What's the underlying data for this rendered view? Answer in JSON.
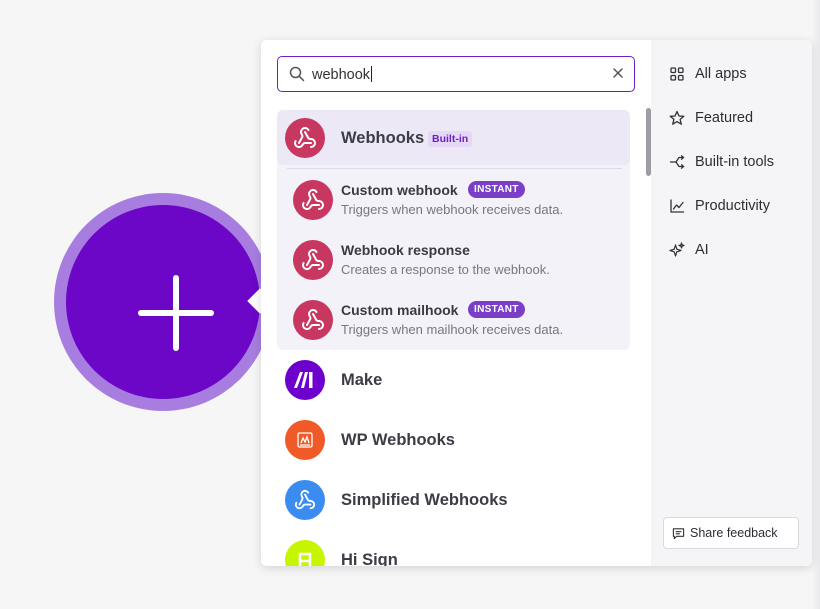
{
  "search": {
    "value": "webhook"
  },
  "group": {
    "title": "Webhooks",
    "badge": "Built-in",
    "modules": [
      {
        "title": "Custom webhook",
        "badge": "INSTANT",
        "desc": "Triggers when webhook receives data."
      },
      {
        "title": "Webhook response",
        "badge": "",
        "desc": "Creates a response to the webhook."
      },
      {
        "title": "Custom mailhook",
        "badge": "INSTANT",
        "desc": "Triggers when mailhook receives data."
      }
    ]
  },
  "apps": [
    {
      "name": "Make",
      "icon": "make-icon",
      "color": "#6d00cc"
    },
    {
      "name": "WP Webhooks",
      "icon": "wp-webhooks-icon",
      "color": "#f05a28"
    },
    {
      "name": "Simplified Webhooks",
      "icon": "webhook-icon",
      "color": "#3b8cf0"
    },
    {
      "name": "Hi Sign",
      "icon": "hi-sign-icon",
      "color": "#c6f500"
    }
  ],
  "categories": [
    {
      "label": "All apps",
      "icon": "grid-icon"
    },
    {
      "label": "Featured",
      "icon": "star-icon"
    },
    {
      "label": "Built-in tools",
      "icon": "branch-icon"
    },
    {
      "label": "Productivity",
      "icon": "trend-icon"
    },
    {
      "label": "AI",
      "icon": "sparkle-icon"
    }
  ],
  "feedback": {
    "label": "Share feedback"
  },
  "colors": {
    "accent": "#6c07c7",
    "webhook_red": "#c8375f",
    "instant_badge": "#7b3fc7"
  }
}
